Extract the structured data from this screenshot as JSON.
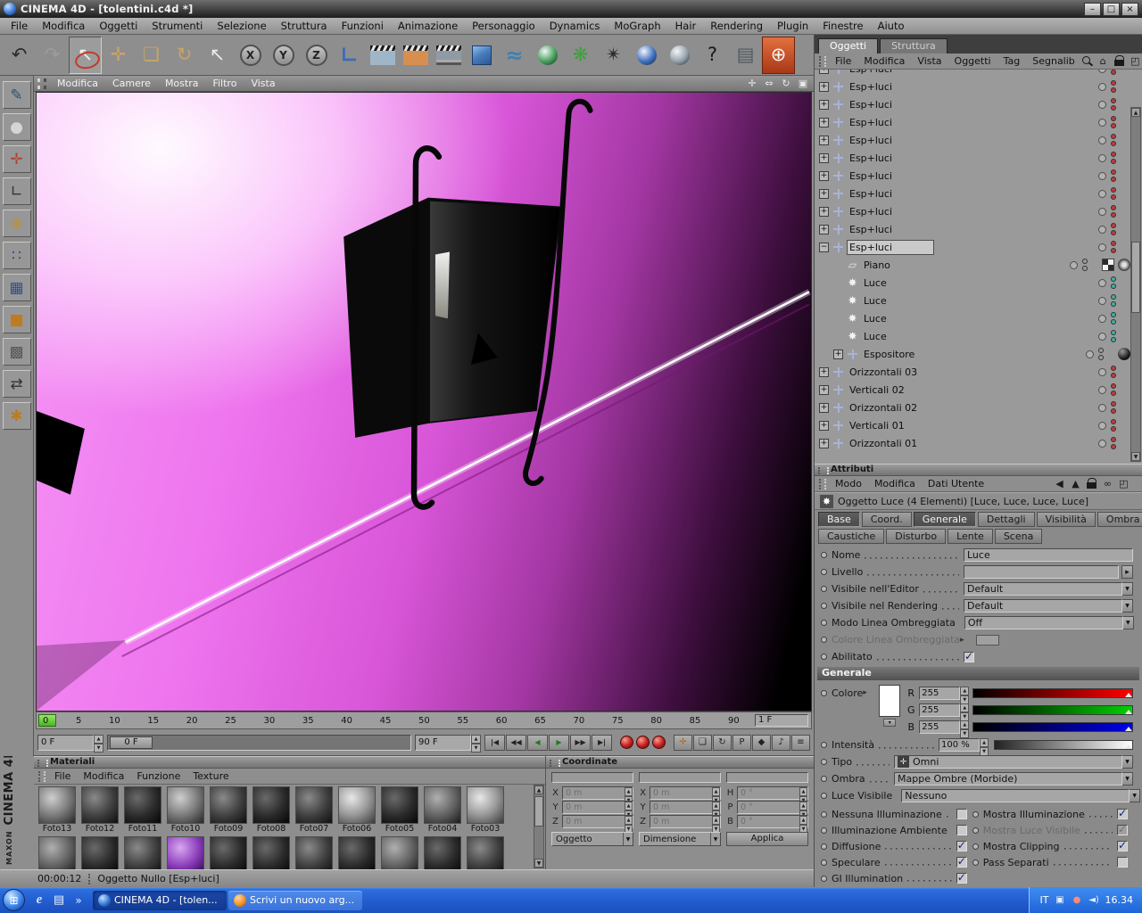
{
  "colors": {
    "accent_magenta": "#ee6bee",
    "ui_gray": "#8e8e8e",
    "taskbar_blue": "#2460d2",
    "record_red": "#c02020",
    "swatch_white": "#ffffff"
  },
  "titlebar": {
    "title": "CINEMA 4D - [tolentini.c4d *]",
    "buttons": [
      {
        "name": "minimize-button",
        "g": "–"
      },
      {
        "name": "restore-button",
        "g": "□"
      },
      {
        "name": "close-button",
        "g": "×"
      }
    ]
  },
  "menubar": {
    "items": [
      "File",
      "Modifica",
      "Oggetti",
      "Strumenti",
      "Selezione",
      "Struttura",
      "Funzioni",
      "Animazione",
      "Personaggio",
      "Dynamics",
      "MoGraph",
      "Hair",
      "Rendering",
      "Plugin",
      "Finestre",
      "Aiuto"
    ]
  },
  "toolbar": {
    "items": [
      {
        "name": "undo-icon",
        "g": "↶",
        "fg": "#2b2b2b"
      },
      {
        "name": "redo-icon",
        "g": "↷",
        "fg": "#9d9d9d"
      },
      {
        "name": "live-selection-tool",
        "g": "↖",
        "fg": "#f0f0f0",
        "cls": "pressed ring"
      },
      {
        "name": "move-tool",
        "g": "✛",
        "fg": "#c9a465"
      },
      {
        "name": "scale-tool",
        "g": "❏",
        "fg": "#c9a465"
      },
      {
        "name": "rotate-tool",
        "g": "↻",
        "fg": "#c9a465"
      },
      {
        "name": "current-tool-icon",
        "g": "↖",
        "fg": "#ececec"
      },
      {
        "name": "lock-x-axis-button",
        "g": "X",
        "cls": "circle"
      },
      {
        "name": "lock-y-axis-button",
        "g": "Y",
        "cls": "circle"
      },
      {
        "name": "lock-z-axis-button",
        "g": "Z",
        "cls": "circle"
      },
      {
        "name": "coordinate-system-button",
        "g": "∟",
        "fg": "#3d6db3",
        "cls": "bigglyph"
      },
      {
        "name": "render-view-button",
        "cls": "clapper cl-gray"
      },
      {
        "name": "render-picture-viewer-button",
        "cls": "clapper cl-orange"
      },
      {
        "name": "render-settings-button",
        "cls": "clapper cl-lines"
      },
      {
        "name": "add-cube-button",
        "cls": "cube3d"
      },
      {
        "name": "add-spline-button",
        "g": "≈",
        "fg": "#3f7fae",
        "cls": "bigglyph"
      },
      {
        "name": "add-generator-button",
        "cls": "ball ball-green"
      },
      {
        "name": "mograph-button",
        "g": "❋",
        "fg": "#3f9e3f"
      },
      {
        "name": "particles-button",
        "g": "✴",
        "fg": "#2f2f2f"
      },
      {
        "name": "add-deformer-button",
        "cls": "ball ball-blue"
      },
      {
        "name": "scene-button",
        "cls": "ball ball-gray"
      },
      {
        "name": "help-button",
        "g": "?",
        "fg": "#1a1a1a"
      },
      {
        "name": "content-browser-button",
        "g": "▤",
        "fg": "#4e5860"
      },
      {
        "name": "online-updater-button",
        "g": "⊕",
        "fg": "#f5f5f5",
        "cls": "tile-red"
      }
    ]
  },
  "sidebar": {
    "items": [
      {
        "name": "make-editable-icon",
        "g": "✎",
        "fg": "#2f4f6f"
      },
      {
        "name": "model-mode-icon",
        "g": "●",
        "fg": "#d5d5d5"
      },
      {
        "name": "texture-axis-icon",
        "g": "✛",
        "fg": "#b04030"
      },
      {
        "name": "workplane-icon",
        "g": "∟",
        "fg": "#333333"
      },
      {
        "name": "object-axis-icon",
        "g": "⊕",
        "fg": "#c09030"
      },
      {
        "name": "points-mode-icon",
        "g": "∷",
        "fg": "#2f4f8f"
      },
      {
        "name": "edges-mode-icon",
        "g": "▦",
        "fg": "#2f4f8f"
      },
      {
        "name": "polygons-mode-icon",
        "g": "■",
        "fg": "#c07a20"
      },
      {
        "name": "texture-mode-icon",
        "g": "▩",
        "fg": "#555555"
      },
      {
        "name": "uv-mode-icon",
        "g": "⇄",
        "fg": "#333333"
      },
      {
        "name": "snap-icon",
        "g": "✱",
        "fg": "#c07a20"
      }
    ]
  },
  "viewport": {
    "menu": [
      "Modifica",
      "Camere",
      "Mostra",
      "Filtro",
      "Vista"
    ],
    "tools": [
      {
        "name": "pan-view-icon",
        "g": "✛"
      },
      {
        "name": "zoom-view-icon",
        "g": "⇔"
      },
      {
        "name": "rotate-view-icon",
        "g": "↻"
      },
      {
        "name": "maximize-view-icon",
        "g": "▣"
      }
    ]
  },
  "timeline": {
    "ticks": [
      "0",
      "5",
      "10",
      "15",
      "20",
      "25",
      "30",
      "35",
      "40",
      "45",
      "50",
      "55",
      "60",
      "65",
      "70",
      "75",
      "80",
      "85",
      "90"
    ],
    "end_box": "1 F"
  },
  "transport": {
    "start_frame": "0 F",
    "slider_value": "0 F",
    "end_frame": "90 F",
    "nav": [
      {
        "name": "goto-start-button",
        "g": "|◀"
      },
      {
        "name": "prev-frame-button",
        "g": "◀◀"
      },
      {
        "name": "play-backward-button",
        "g": "◀",
        "fg": "#1e7a1e"
      },
      {
        "name": "play-forward-button",
        "g": "▶",
        "fg": "#1e7a1e"
      },
      {
        "name": "next-frame-button",
        "g": "▶▶"
      },
      {
        "name": "goto-end-button",
        "g": "▶|"
      }
    ],
    "records": [
      {
        "name": "record-keyframe-button"
      },
      {
        "name": "autokeying-button"
      },
      {
        "name": "record-selection-button"
      }
    ],
    "toggles": [
      {
        "name": "keyframe-position-toggle",
        "g": "✛",
        "fg": "#b06a10"
      },
      {
        "name": "keyframe-scale-toggle",
        "g": "❏"
      },
      {
        "name": "keyframe-rotation-toggle",
        "g": "↻"
      },
      {
        "name": "keyframe-parameter-toggle",
        "g": "P"
      },
      {
        "name": "keyframe-pla-toggle",
        "g": "◆"
      },
      {
        "name": "sound-toggle",
        "g": "♪"
      },
      {
        "name": "transport-options-toggle",
        "g": "≡"
      }
    ]
  },
  "materials": {
    "title": "Materiali",
    "menu": [
      "File",
      "Modifica",
      "Funzione",
      "Texture"
    ],
    "row1": [
      {
        "l": "Foto13",
        "cls": "m2"
      },
      {
        "l": "Foto12",
        "cls": "m4"
      },
      {
        "l": "Foto11",
        "cls": "m5"
      },
      {
        "l": "Foto10",
        "cls": "m2"
      },
      {
        "l": "Foto09",
        "cls": "m4"
      },
      {
        "l": "Foto08",
        "cls": "m5"
      },
      {
        "l": "Foto07",
        "cls": "m4"
      },
      {
        "l": "Foto06",
        "cls": "m1"
      },
      {
        "l": "Foto05",
        "cls": "m5"
      },
      {
        "l": "Foto04",
        "cls": "m3"
      },
      {
        "l": "Foto03",
        "cls": "m1"
      }
    ],
    "row2": [
      {
        "cls": "m3"
      },
      {
        "cls": "m5"
      },
      {
        "cls": "m4"
      },
      {
        "cls": "mpurple"
      },
      {
        "cls": "m5"
      },
      {
        "cls": "m5"
      },
      {
        "cls": "m4"
      },
      {
        "cls": "m5"
      },
      {
        "cls": "m3"
      },
      {
        "cls": "m5"
      },
      {
        "cls": "m4"
      }
    ]
  },
  "coordinates": {
    "title": "Coordinate",
    "position": {
      "rows": [
        {
          "k": "X",
          "v": "0 m"
        },
        {
          "k": "Y",
          "v": "0 m"
        },
        {
          "k": "Z",
          "v": "0 m"
        }
      ],
      "footer": "Oggetto"
    },
    "size": {
      "rows": [
        {
          "k": "X",
          "v": "0 m"
        },
        {
          "k": "Y",
          "v": "0 m"
        },
        {
          "k": "Z",
          "v": "0 m"
        }
      ],
      "footer": "Dimensione"
    },
    "rotation": {
      "rows": [
        {
          "k": "H",
          "v": "0 °"
        },
        {
          "k": "P",
          "v": "0 °"
        },
        {
          "k": "B",
          "v": "0 °"
        }
      ],
      "footer": "Applica"
    }
  },
  "om": {
    "tabs": [
      "Oggetti",
      "Struttura"
    ],
    "menu": [
      "File",
      "Modifica",
      "Vista",
      "Oggetti",
      "Tag",
      "Segnalib"
    ],
    "icons": [
      {
        "name": "om-search-icon",
        "cls": "ic-search"
      },
      {
        "name": "om-home-icon",
        "g": "⌂"
      },
      {
        "name": "om-lock-icon",
        "cls": "ic-lock"
      },
      {
        "name": "om-dock-icon",
        "g": "◰"
      }
    ],
    "tree": [
      {
        "l": "Esp+luci",
        "ind": 0,
        "exp": "+",
        "icon": "ic-null",
        "dots": "dots-red"
      },
      {
        "l": "Esp+luci",
        "ind": 0,
        "exp": "+",
        "icon": "ic-null",
        "dots": "dots-red"
      },
      {
        "l": "Esp+luci",
        "ind": 0,
        "exp": "+",
        "icon": "ic-null",
        "dots": "dots-red"
      },
      {
        "l": "Esp+luci",
        "ind": 0,
        "exp": "+",
        "icon": "ic-null",
        "dots": "dots-red"
      },
      {
        "l": "Esp+luci",
        "ind": 0,
        "exp": "+",
        "icon": "ic-null",
        "dots": "dots-red"
      },
      {
        "l": "Esp+luci",
        "ind": 0,
        "exp": "+",
        "icon": "ic-null",
        "dots": "dots-red"
      },
      {
        "l": "Esp+luci",
        "ind": 0,
        "exp": "+",
        "icon": "ic-null",
        "dots": "dots-red"
      },
      {
        "l": "Esp+luci",
        "ind": 0,
        "exp": "+",
        "icon": "ic-null",
        "dots": "dots-red"
      },
      {
        "l": "Esp+luci",
        "ind": 0,
        "exp": "+",
        "icon": "ic-null",
        "dots": "dots-red"
      },
      {
        "l": "Esp+luci",
        "ind": 0,
        "exp": "+",
        "icon": "ic-null",
        "dots": "dots-red"
      },
      {
        "l": "Esp+luci",
        "ind": 0,
        "exp": "−",
        "icon": "ic-null",
        "dots": "dots-red",
        "rcls": "sel"
      },
      {
        "l": "Piano",
        "ind": 1,
        "icon": "ic-plane",
        "dots": "dots-gray",
        "tag": "tag-piano"
      },
      {
        "l": "Luce",
        "ind": 1,
        "icon": "ic-light",
        "dots": "dots-teal"
      },
      {
        "l": "Luce",
        "ind": 1,
        "icon": "ic-light",
        "dots": "dots-teal"
      },
      {
        "l": "Luce",
        "ind": 1,
        "icon": "ic-light",
        "dots": "dots-teal"
      },
      {
        "l": "Luce",
        "ind": 1,
        "icon": "ic-light",
        "dots": "dots-teal"
      },
      {
        "l": "Espositore",
        "ind": 1,
        "exp": "+",
        "icon": "ic-null",
        "dots": "dots-gray",
        "tag": "tag-sphere"
      },
      {
        "l": "Orizzontali 03",
        "ind": 0,
        "exp": "+",
        "icon": "ic-null",
        "dots": "dots-red"
      },
      {
        "l": "Verticali 02",
        "ind": 0,
        "exp": "+",
        "icon": "ic-null",
        "dots": "dots-red"
      },
      {
        "l": "Orizzontali 02",
        "ind": 0,
        "exp": "+",
        "icon": "ic-null",
        "dots": "dots-red"
      },
      {
        "l": "Verticali 01",
        "ind": 0,
        "exp": "+",
        "icon": "ic-null",
        "dots": "dots-red"
      },
      {
        "l": "Orizzontali 01",
        "ind": 0,
        "exp": "+",
        "icon": "ic-null",
        "dots": "dots-red"
      }
    ]
  },
  "attributes": {
    "title": "Attributi",
    "menu": [
      "Modo",
      "Modifica",
      "Dati Utente"
    ],
    "icons": [
      {
        "name": "attr-back-icon",
        "g": "◀"
      },
      {
        "name": "attr-up-icon",
        "g": "▲"
      },
      {
        "name": "attr-lock-icon",
        "cls": "ic-lock"
      },
      {
        "name": "attr-link-icon",
        "g": "∞"
      },
      {
        "name": "attr-dock-icon",
        "g": "◰"
      }
    ],
    "object_line": "Oggetto Luce (4 Elementi) [Luce, Luce, Luce, Luce]",
    "tabs_row1": [
      {
        "l": "Base",
        "cls": "active"
      },
      {
        "l": "Coord."
      },
      {
        "l": "Generale",
        "cls": "active"
      },
      {
        "l": "Dettagli"
      },
      {
        "l": "Visibilità"
      },
      {
        "l": "Ombra"
      }
    ],
    "tabs_row2": [
      {
        "l": "Caustiche"
      },
      {
        "l": "Disturbo"
      },
      {
        "l": "Lente"
      },
      {
        "l": "Scena"
      }
    ],
    "fields": {
      "nome_label": "Nome",
      "nome_value": "Luce",
      "livello_label": "Livello",
      "vis_editor_label": "Visibile nell'Editor",
      "vis_editor_value": "Default",
      "vis_render_label": "Visibile nel Rendering",
      "vis_render_value": "Default",
      "modo_linea_label": "Modo Linea Ombreggiata",
      "modo_linea_value": "Off",
      "colore_linea_label": "Colore Linea Ombreggiata",
      "abilitato_label": "Abilitato"
    },
    "generale": {
      "header": "Generale",
      "colore_label": "Colore",
      "rgb": [
        {
          "ch": "R",
          "v": "255",
          "cls": "gr-r"
        },
        {
          "ch": "G",
          "v": "255",
          "cls": "gr-g"
        },
        {
          "ch": "B",
          "v": "255",
          "cls": "gr-b"
        }
      ],
      "intensita_label": "Intensità",
      "intensita_value": "100 %",
      "tipo_label": "Tipo",
      "tipo_value": "Omni",
      "ombra_label": "Ombra",
      "ombra_value": "Mappe Ombre (Morbide)",
      "luce_visibile_label": "Luce Visibile",
      "luce_visibile_value": "Nessuno",
      "checks": [
        {
          "l": "Nessuna Illuminazione"
        },
        {
          "l": "Mostra Illuminazione",
          "cls": "on"
        },
        {
          "l": "Illuminazione Ambiente"
        },
        {
          "l": "Mostra Luce Visibile",
          "cls": "on",
          "rcls": "dis"
        },
        {
          "l": "Diffusione",
          "cls": "on"
        },
        {
          "l": "Mostra Clipping",
          "cls": "on"
        },
        {
          "l": "Speculare",
          "cls": "on"
        },
        {
          "l": "Pass Separati"
        },
        {
          "l": "GI Illumination",
          "cls": "on"
        }
      ]
    }
  },
  "statusbar": {
    "time": "00:00:12",
    "message": "Oggetto Nullo [Esp+luci]"
  },
  "brand": {
    "maxon": "MAXON",
    "c4d": "CINEMA 4D"
  },
  "taskbar": {
    "quicklaunch": [
      {
        "name": "quicklaunch-browser-icon",
        "cls": "qe"
      },
      {
        "name": "quicklaunch-desktop-icon",
        "cls": "qd"
      },
      {
        "name": "quicklaunch-overflow-chevron",
        "cls": "qc"
      }
    ],
    "tasks": [
      {
        "label": "CINEMA 4D - [tolen...",
        "cls": "active",
        "icls": "ic-c4d"
      },
      {
        "label": "Scrivi un nuovo arg...",
        "icls": "ic-ff"
      }
    ],
    "tray": {
      "lang": "IT",
      "clock": "16.34"
    }
  }
}
